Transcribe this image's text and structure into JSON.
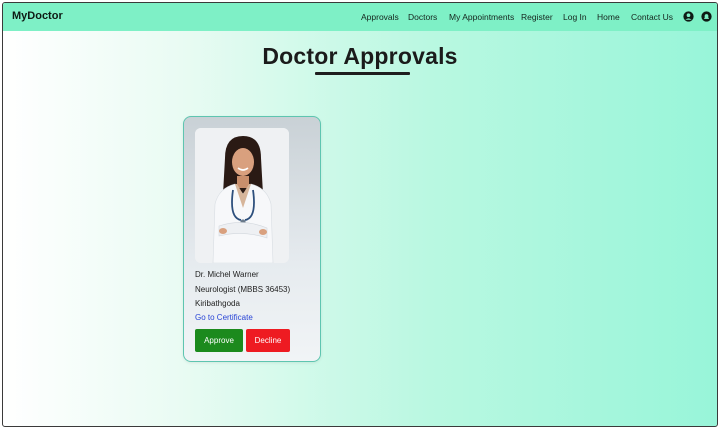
{
  "app": {
    "brand": "MyDoctor"
  },
  "nav": {
    "links": [
      "Approvals",
      "Doctors",
      "My Appointments",
      "Register",
      "Log In",
      "Home",
      "Contact Us"
    ],
    "icons": [
      "user-circle-icon",
      "notification-icon"
    ]
  },
  "page": {
    "title": "Doctor Approvals"
  },
  "doctor": {
    "name": "Dr. Michel Warner",
    "specialty": "Neurologist (MBBS 36453)",
    "location": "Kiribathgoda",
    "certificate_link": "Go to Certificate",
    "approve_label": "Approve",
    "decline_label": "Decline"
  },
  "colors": {
    "navbar": "#7ef0c6",
    "approve": "#1c8a1d",
    "decline": "#ee1b22",
    "link": "#2a45d6"
  }
}
